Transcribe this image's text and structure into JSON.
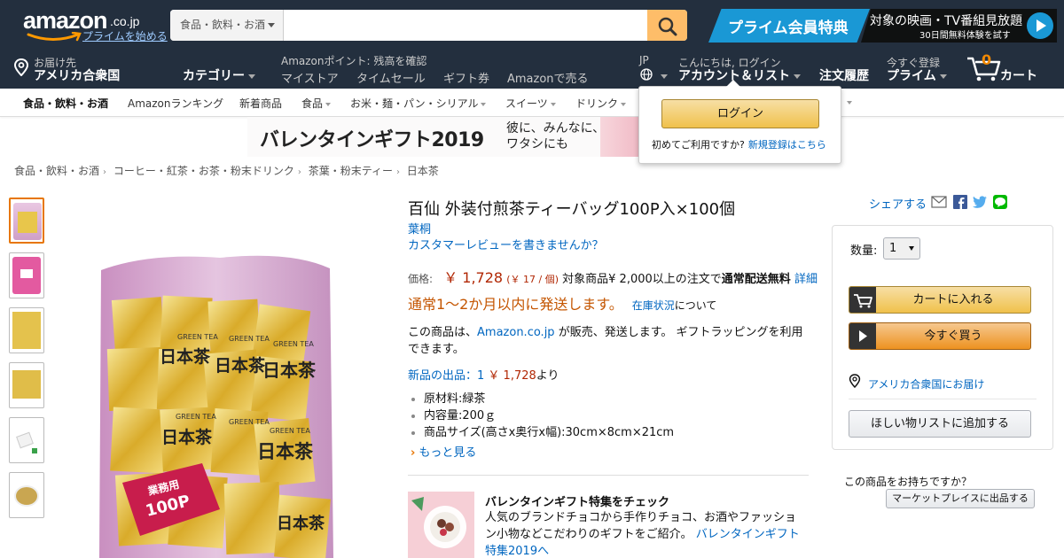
{
  "header": {
    "logo_text": "amazon",
    "logo_tld": ".co.jp",
    "logo_prime_link": "プライムを始める",
    "search": {
      "category": "食品・飲料・お酒",
      "value": ""
    },
    "prime_banner": {
      "left_text": "プライム会員特典",
      "right_line1": "対象の映画・TV番組見放題",
      "right_line2": "30日間無料体験を試す"
    }
  },
  "nav": {
    "deliver_to_label": "お届け先",
    "deliver_to_country": "アメリカ合衆国",
    "category_label": "カテゴリー",
    "points_text": "Amazonポイント: 残高を確認",
    "links": [
      "マイストア",
      "タイムセール",
      "ギフト券",
      "Amazonで売る"
    ],
    "lang": "JP",
    "greeting": "こんにちは, ログイン",
    "account_label": "アカウント＆リスト",
    "orders_label": "注文履歴",
    "prime_small": "今すぐ登録",
    "prime_label": "プライム",
    "cart_count": "0",
    "cart_label": "カート"
  },
  "subnav": [
    "食品・飲料・お酒",
    "Amazonランキング",
    "新着商品",
    "食品",
    "お米・麺・パン・シリアル",
    "スイーツ",
    "ドリンク"
  ],
  "promo_banner": {
    "title": "バレンタインギフト2019",
    "line1": "彼に、みんなに、",
    "line2": "ワタシにも"
  },
  "breadcrumb": [
    "食品・飲料・お酒",
    "コーヒー・紅茶・お茶・粉末ドリンク",
    "茶葉・粉末ティー",
    "日本茶"
  ],
  "product": {
    "title": "百仙 外装付煎茶ティーバッグ100P入×100個",
    "brand": "葉桐",
    "review_link": "カスタマーレビューを書きませんか？",
    "price_label": "価格:",
    "price": "￥ 1,728",
    "unit_price": "(￥ 17 / 個)",
    "shipping_note": "対象商品¥ 2,000以上の注文で",
    "free_shipping": "通常配送無料",
    "details_link": "詳細",
    "ship_time": "通常1～2か月以内に発送します。",
    "stock_link": "在庫状況",
    "stock_about": "について",
    "seller_pre": "この商品は、",
    "seller_link": "Amazon.co.jp",
    "seller_post": " が販売、発送します。 ギフトラッピングを利用できます。",
    "new_offers_link": "新品の出品：1",
    "new_offers_price": "￥ 1,728",
    "new_offers_post": "より",
    "bullets": [
      "原材料:緑茶",
      "内容量:200ｇ",
      "商品サイズ(高さx奥行x幅):30cm×8cm×21cm"
    ],
    "see_more": "もっと見る"
  },
  "feature": {
    "title": "バレンタインギフト特集をチェック",
    "desc": "人気のブランドチョコから手作りチョコ、お酒やファッション小物などこだわりのギフトをご紹介。",
    "link": "バレンタインギフト特集2019へ"
  },
  "share": {
    "label": "シェアする"
  },
  "buybox": {
    "qty_label": "数量:",
    "qty_value": "1",
    "add_to_cart": "カートに入れる",
    "buy_now": "今すぐ買う",
    "deliver_link": "アメリカ合衆国にお届け",
    "wishlist": "ほしい物リストに追加する",
    "have_one": "この商品をお持ちですか？",
    "marketplace": "マーケットプレイスに出品する"
  },
  "flyout": {
    "login_button": "ログイン",
    "first_time": "初めてご利用ですか?",
    "register_link": "新規登録はこちら"
  },
  "colors": {
    "nav_bg": "#232f3e",
    "search_btn": "#febd69",
    "price": "#b12704",
    "ship_orange": "#c45500",
    "link": "#0066c0",
    "prime_blue": "#1a98d5"
  },
  "product_image_labels": {
    "tea_name": "日本茶",
    "green_tea": "GREEN TEA",
    "tag_top": "業務用",
    "tag_bottom": "100P"
  }
}
